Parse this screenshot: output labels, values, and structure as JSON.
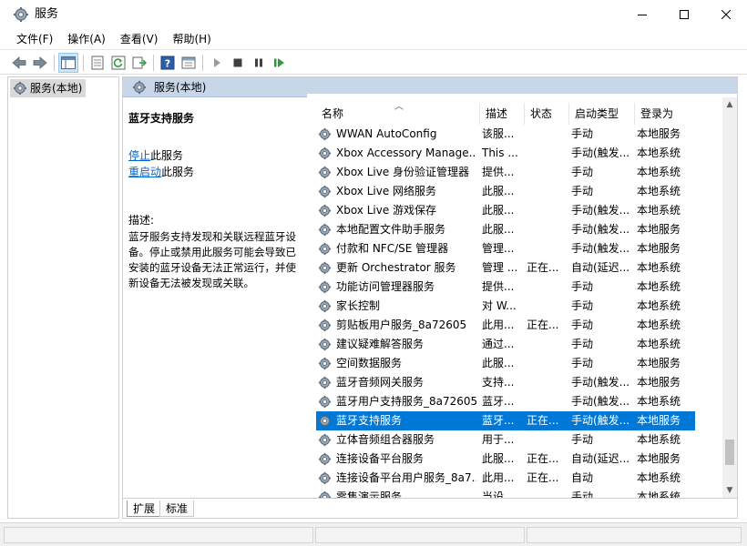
{
  "window": {
    "title": "服务"
  },
  "menu": {
    "items": [
      "文件(F)",
      "操作(A)",
      "查看(V)",
      "帮助(H)"
    ]
  },
  "tree": {
    "selected_label": "服务(本地)"
  },
  "pane": {
    "header_title": "服务(本地)"
  },
  "details": {
    "service_title": "蓝牙支持服务",
    "stop_link": "停止",
    "stop_suffix": "此服务",
    "restart_link": "重启动",
    "restart_suffix": "此服务",
    "desc_label": "描述:",
    "desc_text": "蓝牙服务支持发现和关联远程蓝牙设备。停止或禁用此服务可能会导致已安装的蓝牙设备无法正常运行，并使新设备无法被发现或关联。"
  },
  "columns": {
    "name": "名称",
    "description": "描述",
    "status": "状态",
    "startup": "启动类型",
    "logon": "登录为"
  },
  "rows": [
    {
      "name": "WWAN AutoConfig",
      "desc": "该服...",
      "status": "",
      "startup": "手动",
      "logon": "本地服务"
    },
    {
      "name": "Xbox Accessory Manage...",
      "desc": "This ...",
      "status": "",
      "startup": "手动(触发...",
      "logon": "本地系统"
    },
    {
      "name": "Xbox Live 身份验证管理器",
      "desc": "提供...",
      "status": "",
      "startup": "手动",
      "logon": "本地系统"
    },
    {
      "name": "Xbox Live 网络服务",
      "desc": "此服...",
      "status": "",
      "startup": "手动",
      "logon": "本地系统"
    },
    {
      "name": "Xbox Live 游戏保存",
      "desc": "此服...",
      "status": "",
      "startup": "手动(触发...",
      "logon": "本地系统"
    },
    {
      "name": "本地配置文件助手服务",
      "desc": "此服...",
      "status": "",
      "startup": "手动(触发...",
      "logon": "本地服务"
    },
    {
      "name": "付款和 NFC/SE 管理器",
      "desc": "管理...",
      "status": "",
      "startup": "手动(触发...",
      "logon": "本地服务"
    },
    {
      "name": "更新 Orchestrator 服务",
      "desc": "管理 ...",
      "status": "正在...",
      "startup": "自动(延迟...",
      "logon": "本地系统"
    },
    {
      "name": "功能访问管理器服务",
      "desc": "提供...",
      "status": "",
      "startup": "手动",
      "logon": "本地系统"
    },
    {
      "name": "家长控制",
      "desc": "对 W...",
      "status": "",
      "startup": "手动",
      "logon": "本地系统"
    },
    {
      "name": "剪贴板用户服务_8a72605",
      "desc": "此用...",
      "status": "正在...",
      "startup": "手动",
      "logon": "本地系统"
    },
    {
      "name": "建议疑难解答服务",
      "desc": "通过...",
      "status": "",
      "startup": "手动",
      "logon": "本地系统"
    },
    {
      "name": "空间数据服务",
      "desc": "此服...",
      "status": "",
      "startup": "手动",
      "logon": "本地服务"
    },
    {
      "name": "蓝牙音频网关服务",
      "desc": "支持...",
      "status": "",
      "startup": "手动(触发...",
      "logon": "本地服务"
    },
    {
      "name": "蓝牙用户支持服务_8a72605",
      "desc": "蓝牙...",
      "status": "",
      "startup": "手动(触发...",
      "logon": "本地系统"
    },
    {
      "name": "蓝牙支持服务",
      "desc": "蓝牙...",
      "status": "正在...",
      "startup": "手动(触发...",
      "logon": "本地服务",
      "selected": true
    },
    {
      "name": "立体音频组合器服务",
      "desc": "用于...",
      "status": "",
      "startup": "手动",
      "logon": "本地系统"
    },
    {
      "name": "连接设备平台服务",
      "desc": "此服...",
      "status": "正在...",
      "startup": "自动(延迟...",
      "logon": "本地服务"
    },
    {
      "name": "连接设备平台用户服务_8a7...",
      "desc": "此用...",
      "status": "正在...",
      "startup": "自动",
      "logon": "本地系统"
    },
    {
      "name": "零售演示服务",
      "desc": "当设...",
      "status": "",
      "startup": "手动",
      "logon": "本地系统"
    }
  ],
  "tabs": {
    "extended": "扩展",
    "standard": "标准"
  },
  "icons": {
    "accent": "#0078d7"
  }
}
